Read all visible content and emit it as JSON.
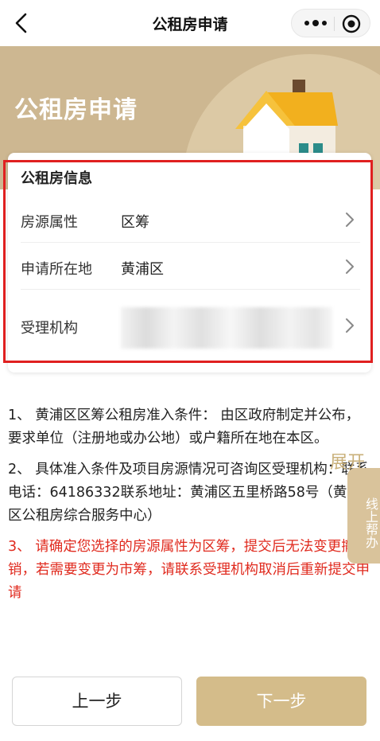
{
  "nav": {
    "title": "公租房申请"
  },
  "banner": {
    "title": "公租房申请"
  },
  "card": {
    "heading": "公租房信息",
    "rows": [
      {
        "label": "房源属性",
        "value": "区筹"
      },
      {
        "label": "申请所在地",
        "value": "黄浦区"
      },
      {
        "label": "受理机构",
        "value": ""
      }
    ]
  },
  "notes": [
    "1、 黄浦区区筹公租房准入条件： 由区政府制定并公布，要求单位（注册地或办公地）或户籍所在地在本区。",
    "2、 具体准入条件及项目房源情况可咨询区受理机构：联系电话：64186332联系地址：黄浦区五里桥路58号（黄浦区公租房综合服务中心）",
    "3、 请确定您选择的房源属性为区筹，提交后无法变更撤销，若需要变更为市筹，请联系受理机构取消后重新提交申请"
  ],
  "expand_label": "展开",
  "helper_label": "线上帮办",
  "buttons": {
    "prev": "上一步",
    "next": "下一步"
  },
  "colors": {
    "accent": "#d4bc8a",
    "banner": "#cdb791",
    "warning": "#e02a1e",
    "highlight": "#e02020"
  }
}
